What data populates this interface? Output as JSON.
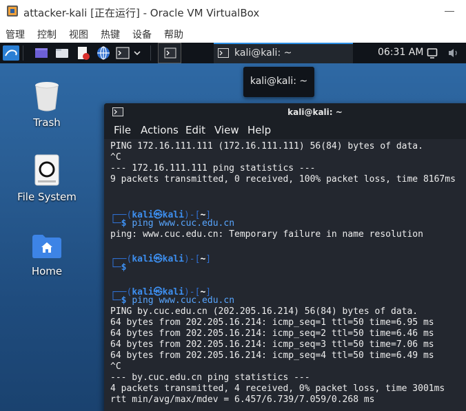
{
  "window": {
    "title": "attacker-kali [正在运行] - Oracle VM VirtualBox"
  },
  "menubar": [
    "管理",
    "控制",
    "视图",
    "热键",
    "设备",
    "帮助"
  ],
  "panel": {
    "task_label": "kali@kali: ~",
    "clock": "06:31 AM",
    "tooltip": "kali@kali: ~"
  },
  "desktop": {
    "icons": [
      "Trash",
      "File System",
      "Home"
    ]
  },
  "terminal": {
    "title": "kali@kali: ~",
    "menu": [
      "File",
      "Actions",
      "Edit",
      "View",
      "Help"
    ],
    "prompt": {
      "user": "kali",
      "at": "㉿",
      "host": "kali",
      "dir": "~",
      "symbol": "$"
    },
    "lines": {
      "l0": "PING 172.16.111.111 (172.16.111.111) 56(84) bytes of data.",
      "l1": "^C",
      "l2": "--- 172.16.111.111 ping statistics ---",
      "l3": "9 packets transmitted, 0 received, 100% packet loss, time 8167ms",
      "cmd1": "ping www.cuc.edu.cn",
      "l4": "ping: www.cuc.edu.cn: Temporary failure in name resolution",
      "cmd2": "ping www.cuc.edu.cn",
      "l5": "PING by.cuc.edu.cn (202.205.16.214) 56(84) bytes of data.",
      "l6": "64 bytes from 202.205.16.214: icmp_seq=1 ttl=50 time=6.95 ms",
      "l7": "64 bytes from 202.205.16.214: icmp_seq=2 ttl=50 time=6.46 ms",
      "l8": "64 bytes from 202.205.16.214: icmp_seq=3 ttl=50 time=7.06 ms",
      "l9": "64 bytes from 202.205.16.214: icmp_seq=4 ttl=50 time=6.49 ms",
      "l10": "^C",
      "l11": "--- by.cuc.edu.cn ping statistics ---",
      "l12": "4 packets transmitted, 4 received, 0% packet loss, time 3001ms",
      "l13": "rtt min/avg/max/mdev = 6.457/6.739/7.059/0.268 ms"
    }
  },
  "colors": {
    "accent": "#2c8fe6",
    "prompt": "#2f6fcf",
    "terminal_bg": "#23272f",
    "panel_bg": "#10141a"
  }
}
